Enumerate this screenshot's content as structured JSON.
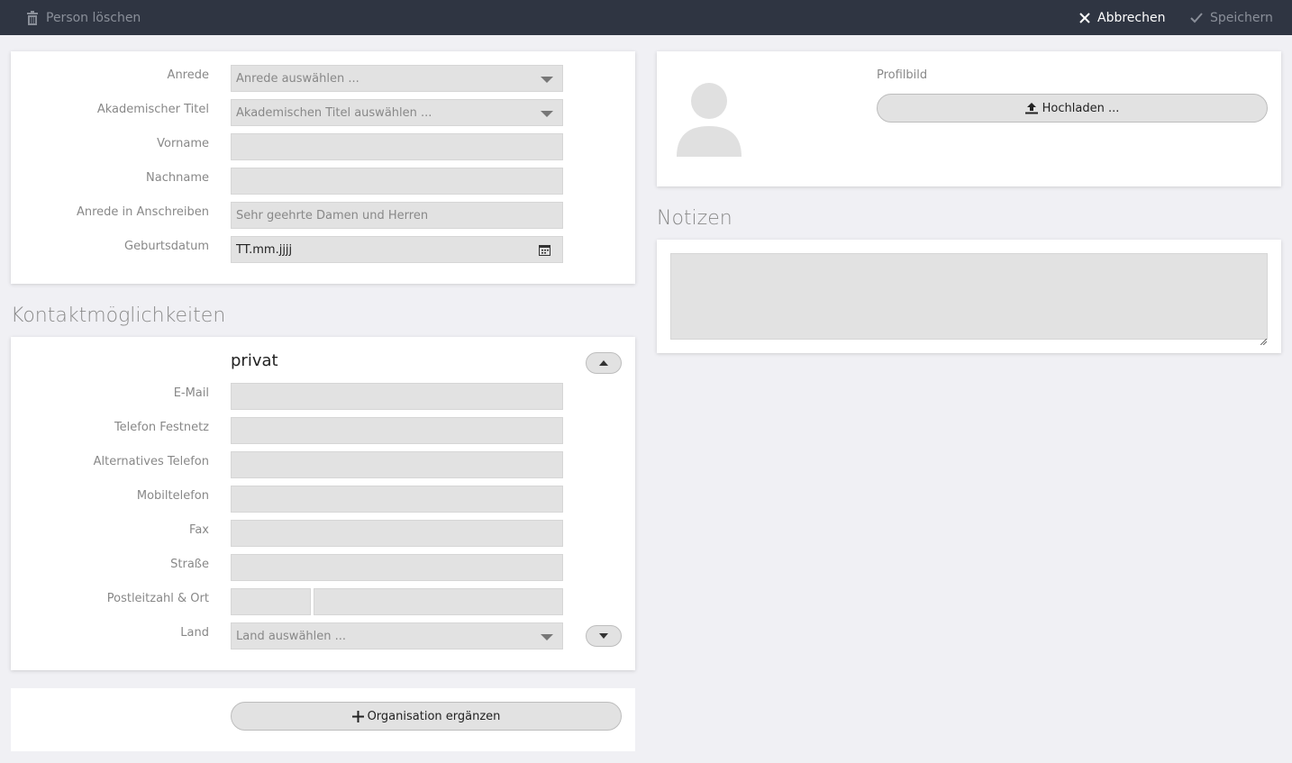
{
  "topbar": {
    "delete_label": "Person löschen",
    "cancel_label": "Abbrechen",
    "save_label": "Speichern"
  },
  "person_form": {
    "salutation": {
      "label": "Anrede",
      "placeholder": "Anrede auswählen ..."
    },
    "academic_title": {
      "label": "Akademischer Titel",
      "placeholder": "Akademischen Titel auswählen ..."
    },
    "first_name": {
      "label": "Vorname",
      "value": ""
    },
    "last_name": {
      "label": "Nachname",
      "value": ""
    },
    "letter_salutation": {
      "label": "Anrede in Anschreiben",
      "placeholder": "Sehr geehrte Damen und Herren"
    },
    "birth_date": {
      "label": "Geburtsdatum",
      "placeholder": "TT.mm.jjjj"
    }
  },
  "profile": {
    "label": "Profilbild",
    "upload_label": "Hochladen ..."
  },
  "notes": {
    "heading": "Notizen",
    "value": ""
  },
  "contact": {
    "heading": "Kontaktmöglichkeiten",
    "group_title": "privat",
    "email_label": "E-Mail",
    "phone_label": "Telefon Festnetz",
    "alt_phone_label": "Alternatives Telefon",
    "mobile_label": "Mobiltelefon",
    "fax_label": "Fax",
    "street_label": "Straße",
    "zip_city_label": "Postleitzahl & Ort",
    "country_label": "Land",
    "country_placeholder": "Land auswählen ..."
  },
  "organisation": {
    "add_label": "Organisation ergänzen"
  },
  "colors": {
    "topbar_bg": "#2f3542",
    "page_bg": "#f0f0f4",
    "field_bg": "#e2e2e2"
  }
}
